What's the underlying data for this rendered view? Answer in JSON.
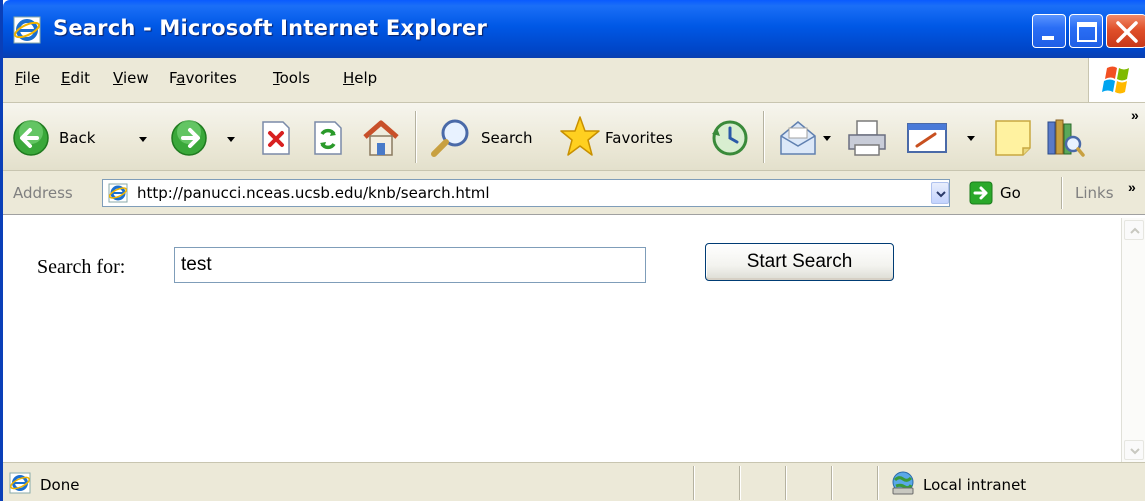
{
  "window": {
    "title": "Search - Microsoft Internet Explorer"
  },
  "menu": {
    "items": [
      {
        "label_ul": "F",
        "label_rest": "ile"
      },
      {
        "label_ul": "E",
        "label_rest": "dit"
      },
      {
        "label_ul": "V",
        "label_rest": "iew"
      },
      {
        "label_pre": "F",
        "label_ul": "a",
        "label_rest": "vorites"
      },
      {
        "label_ul": "T",
        "label_rest": "ools"
      },
      {
        "label_ul": "H",
        "label_rest": "elp"
      }
    ]
  },
  "toolbar": {
    "back_label": "Back",
    "search_label": "Search",
    "favorites_label": "Favorites",
    "overflow": "»"
  },
  "address": {
    "label": "Address",
    "url": "http://panucci.nceas.ucsb.edu/knb/search.html",
    "go_label": "Go",
    "links_label": "Links",
    "links_overflow": "»"
  },
  "page": {
    "search_label": "Search for:",
    "search_value": "test",
    "button_label": "Start Search"
  },
  "status": {
    "text": "Done",
    "zone": "Local intranet"
  }
}
